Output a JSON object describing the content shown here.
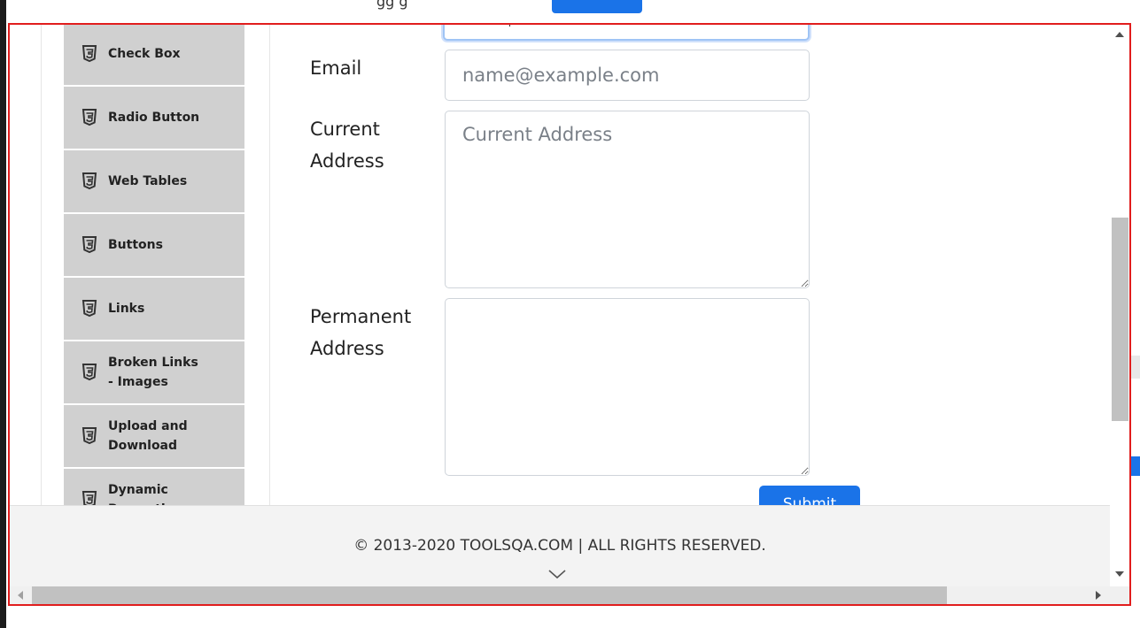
{
  "sidebar": {
    "items": [
      {
        "label": "Check Box"
      },
      {
        "label": "Radio Button"
      },
      {
        "label": "Web Tables"
      },
      {
        "label": "Buttons"
      },
      {
        "label": "Links"
      },
      {
        "label": "Broken Links - Images"
      },
      {
        "label": "Upload and Download"
      },
      {
        "label": "Dynamic Properties"
      }
    ],
    "icon": "html5-icon"
  },
  "form": {
    "email_label": "Email",
    "email_placeholder": "name@example.com",
    "current_address_label": "Current Address",
    "current_address_placeholder": "Current Address",
    "permanent_address_label": "Permanent Address",
    "submit_label": "Submit"
  },
  "footer": {
    "copyright": "© 2013-2020 TOOLSQA.COM | ALL RIGHTS RESERVED."
  },
  "colors": {
    "accent": "#1a73e8",
    "sidebar_bg": "#d0d0d0",
    "frame_border": "#e11d1d"
  }
}
